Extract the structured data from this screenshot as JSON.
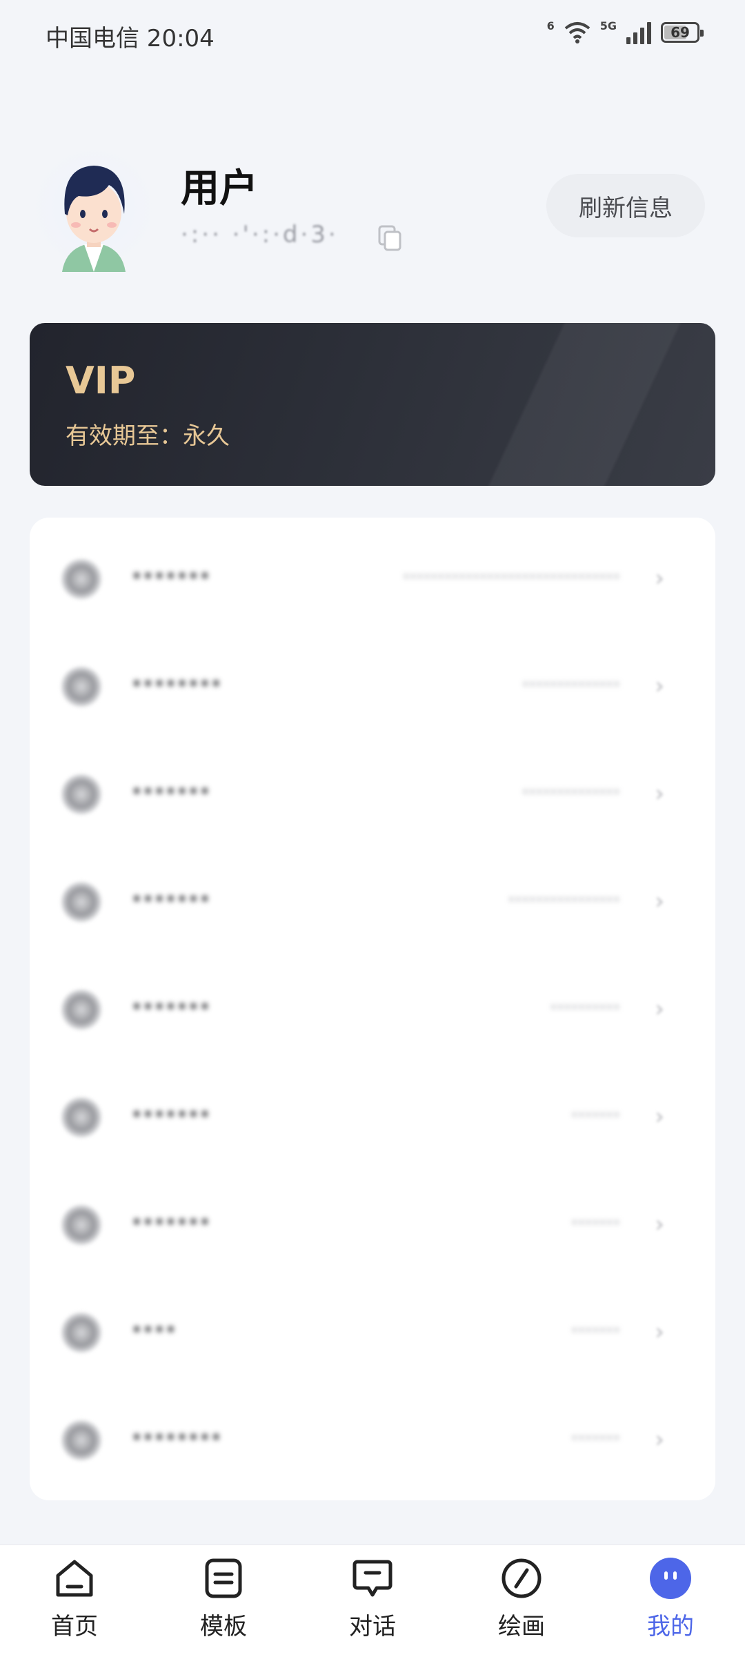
{
  "status_bar": {
    "carrier_time": "中国电信 20:04",
    "wifi_tag": "6",
    "net_tag": "5G",
    "battery": "69"
  },
  "profile": {
    "username": "用户",
    "user_id": "·:·· ·'·:·d·3·",
    "refresh_label": "刷新信息"
  },
  "vip": {
    "title": "VIP",
    "expiry": "有效期至：永久",
    "accent_color": "#e8c896"
  },
  "menu": {
    "items": [
      {
        "label": "·······",
        "value": "·······························",
        "arrow": "›"
      },
      {
        "label": "········",
        "value": "··············",
        "arrow": "›"
      },
      {
        "label": "·······",
        "value": "··············",
        "arrow": "›"
      },
      {
        "label": "·······",
        "value": "················",
        "arrow": "›"
      },
      {
        "label": "·······",
        "value": "··········",
        "arrow": "›"
      },
      {
        "label": "·······",
        "value": "·······",
        "arrow": "›"
      },
      {
        "label": "·······",
        "value": "·······",
        "arrow": "›"
      },
      {
        "label": "····",
        "value": "·······",
        "arrow": "›"
      },
      {
        "label": "········",
        "value": "·······",
        "arrow": "›"
      }
    ]
  },
  "tabs": [
    {
      "label": "首页",
      "icon": "home-icon"
    },
    {
      "label": "模板",
      "icon": "template-icon"
    },
    {
      "label": "对话",
      "icon": "chat-icon"
    },
    {
      "label": "绘画",
      "icon": "draw-icon"
    },
    {
      "label": "我的",
      "icon": "profile-icon",
      "active": true
    }
  ],
  "colors": {
    "accent": "#4d66e8",
    "background": "#f3f5f9"
  }
}
